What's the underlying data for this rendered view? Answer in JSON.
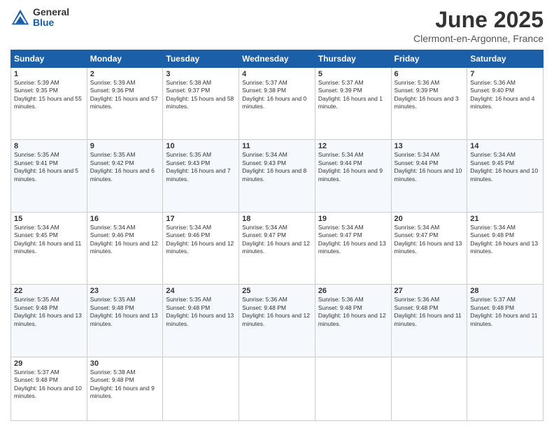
{
  "logo": {
    "general": "General",
    "blue": "Blue"
  },
  "title": "June 2025",
  "location": "Clermont-en-Argonne, France",
  "days": [
    "Sunday",
    "Monday",
    "Tuesday",
    "Wednesday",
    "Thursday",
    "Friday",
    "Saturday"
  ],
  "weeks": [
    [
      {
        "day": "1",
        "sunrise": "Sunrise: 5:39 AM",
        "sunset": "Sunset: 9:35 PM",
        "daylight": "Daylight: 15 hours and 55 minutes."
      },
      {
        "day": "2",
        "sunrise": "Sunrise: 5:39 AM",
        "sunset": "Sunset: 9:36 PM",
        "daylight": "Daylight: 15 hours and 57 minutes."
      },
      {
        "day": "3",
        "sunrise": "Sunrise: 5:38 AM",
        "sunset": "Sunset: 9:37 PM",
        "daylight": "Daylight: 15 hours and 58 minutes."
      },
      {
        "day": "4",
        "sunrise": "Sunrise: 5:37 AM",
        "sunset": "Sunset: 9:38 PM",
        "daylight": "Daylight: 16 hours and 0 minutes."
      },
      {
        "day": "5",
        "sunrise": "Sunrise: 5:37 AM",
        "sunset": "Sunset: 9:39 PM",
        "daylight": "Daylight: 16 hours and 1 minute."
      },
      {
        "day": "6",
        "sunrise": "Sunrise: 5:36 AM",
        "sunset": "Sunset: 9:39 PM",
        "daylight": "Daylight: 16 hours and 3 minutes."
      },
      {
        "day": "7",
        "sunrise": "Sunrise: 5:36 AM",
        "sunset": "Sunset: 9:40 PM",
        "daylight": "Daylight: 16 hours and 4 minutes."
      }
    ],
    [
      {
        "day": "8",
        "sunrise": "Sunrise: 5:35 AM",
        "sunset": "Sunset: 9:41 PM",
        "daylight": "Daylight: 16 hours and 5 minutes."
      },
      {
        "day": "9",
        "sunrise": "Sunrise: 5:35 AM",
        "sunset": "Sunset: 9:42 PM",
        "daylight": "Daylight: 16 hours and 6 minutes."
      },
      {
        "day": "10",
        "sunrise": "Sunrise: 5:35 AM",
        "sunset": "Sunset: 9:43 PM",
        "daylight": "Daylight: 16 hours and 7 minutes."
      },
      {
        "day": "11",
        "sunrise": "Sunrise: 5:34 AM",
        "sunset": "Sunset: 9:43 PM",
        "daylight": "Daylight: 16 hours and 8 minutes."
      },
      {
        "day": "12",
        "sunrise": "Sunrise: 5:34 AM",
        "sunset": "Sunset: 9:44 PM",
        "daylight": "Daylight: 16 hours and 9 minutes."
      },
      {
        "day": "13",
        "sunrise": "Sunrise: 5:34 AM",
        "sunset": "Sunset: 9:44 PM",
        "daylight": "Daylight: 16 hours and 10 minutes."
      },
      {
        "day": "14",
        "sunrise": "Sunrise: 5:34 AM",
        "sunset": "Sunset: 9:45 PM",
        "daylight": "Daylight: 16 hours and 10 minutes."
      }
    ],
    [
      {
        "day": "15",
        "sunrise": "Sunrise: 5:34 AM",
        "sunset": "Sunset: 9:45 PM",
        "daylight": "Daylight: 16 hours and 11 minutes."
      },
      {
        "day": "16",
        "sunrise": "Sunrise: 5:34 AM",
        "sunset": "Sunset: 9:46 PM",
        "daylight": "Daylight: 16 hours and 12 minutes."
      },
      {
        "day": "17",
        "sunrise": "Sunrise: 5:34 AM",
        "sunset": "Sunset: 9:46 PM",
        "daylight": "Daylight: 16 hours and 12 minutes."
      },
      {
        "day": "18",
        "sunrise": "Sunrise: 5:34 AM",
        "sunset": "Sunset: 9:47 PM",
        "daylight": "Daylight: 16 hours and 12 minutes."
      },
      {
        "day": "19",
        "sunrise": "Sunrise: 5:34 AM",
        "sunset": "Sunset: 9:47 PM",
        "daylight": "Daylight: 16 hours and 13 minutes."
      },
      {
        "day": "20",
        "sunrise": "Sunrise: 5:34 AM",
        "sunset": "Sunset: 9:47 PM",
        "daylight": "Daylight: 16 hours and 13 minutes."
      },
      {
        "day": "21",
        "sunrise": "Sunrise: 5:34 AM",
        "sunset": "Sunset: 9:48 PM",
        "daylight": "Daylight: 16 hours and 13 minutes."
      }
    ],
    [
      {
        "day": "22",
        "sunrise": "Sunrise: 5:35 AM",
        "sunset": "Sunset: 9:48 PM",
        "daylight": "Daylight: 16 hours and 13 minutes."
      },
      {
        "day": "23",
        "sunrise": "Sunrise: 5:35 AM",
        "sunset": "Sunset: 9:48 PM",
        "daylight": "Daylight: 16 hours and 13 minutes."
      },
      {
        "day": "24",
        "sunrise": "Sunrise: 5:35 AM",
        "sunset": "Sunset: 9:48 PM",
        "daylight": "Daylight: 16 hours and 13 minutes."
      },
      {
        "day": "25",
        "sunrise": "Sunrise: 5:36 AM",
        "sunset": "Sunset: 9:48 PM",
        "daylight": "Daylight: 16 hours and 12 minutes."
      },
      {
        "day": "26",
        "sunrise": "Sunrise: 5:36 AM",
        "sunset": "Sunset: 9:48 PM",
        "daylight": "Daylight: 16 hours and 12 minutes."
      },
      {
        "day": "27",
        "sunrise": "Sunrise: 5:36 AM",
        "sunset": "Sunset: 9:48 PM",
        "daylight": "Daylight: 16 hours and 11 minutes."
      },
      {
        "day": "28",
        "sunrise": "Sunrise: 5:37 AM",
        "sunset": "Sunset: 9:48 PM",
        "daylight": "Daylight: 16 hours and 11 minutes."
      }
    ],
    [
      {
        "day": "29",
        "sunrise": "Sunrise: 5:37 AM",
        "sunset": "Sunset: 9:48 PM",
        "daylight": "Daylight: 16 hours and 10 minutes."
      },
      {
        "day": "30",
        "sunrise": "Sunrise: 5:38 AM",
        "sunset": "Sunset: 9:48 PM",
        "daylight": "Daylight: 16 hours and 9 minutes."
      },
      null,
      null,
      null,
      null,
      null
    ]
  ]
}
